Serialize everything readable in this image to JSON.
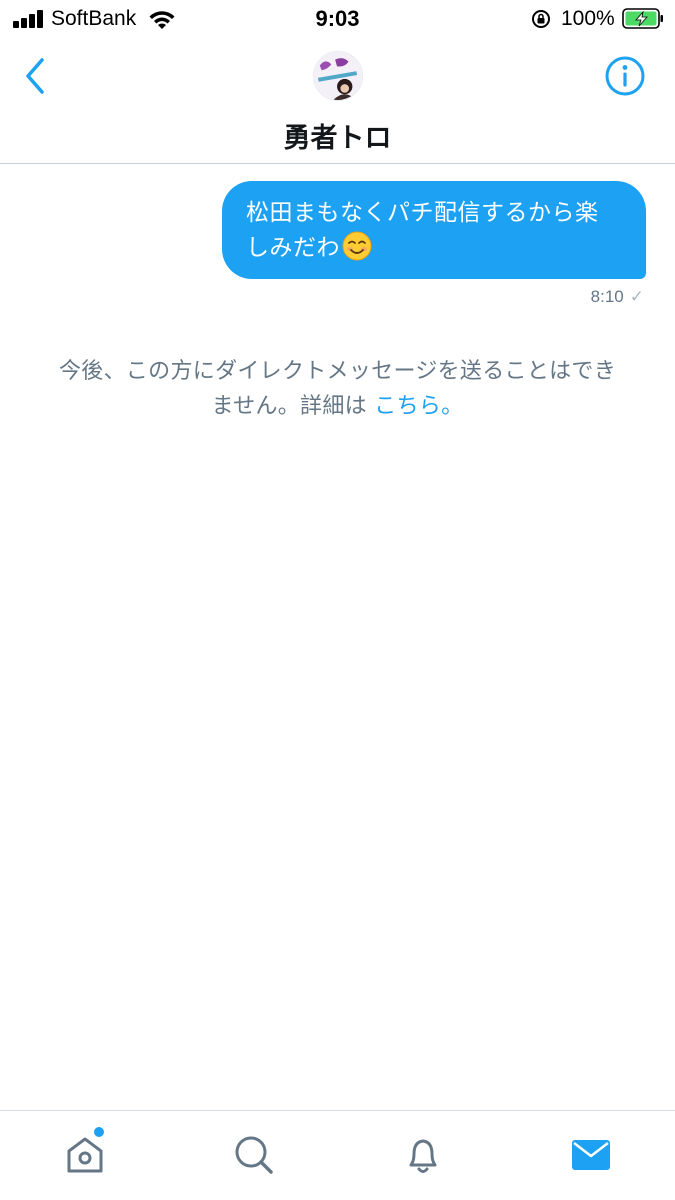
{
  "status_bar": {
    "carrier": "SoftBank",
    "time": "9:03",
    "battery_percent": "100%",
    "battery_level": 1.0,
    "signal_bars": 4
  },
  "header": {
    "contact_name": "勇者トロ",
    "avatar_icon": "user-avatar",
    "back_icon": "chevron-left-icon",
    "info_icon": "info-icon"
  },
  "conversation": {
    "messages": [
      {
        "text_line1": "松田まもなくパチ配信するから楽",
        "text_line2": "しみだわ",
        "emoji": "smiling-face-icon",
        "time": "8:10",
        "status_glyph": "✓"
      }
    ],
    "notice": {
      "text_line1": "今後、この方にダイレクトメッセージを送ることはでき",
      "text_line2": "ません。詳細は",
      "link_text": "こちら。"
    }
  },
  "tab_bar": {
    "tabs": [
      {
        "id": "home",
        "icon": "home-icon",
        "has_unread_dot": true
      },
      {
        "id": "search",
        "icon": "search-icon"
      },
      {
        "id": "notifications",
        "icon": "bell-icon"
      },
      {
        "id": "messages",
        "icon": "envelope-icon",
        "active": true
      }
    ]
  },
  "colors": {
    "accent": "#1da1f2",
    "secondary_text": "#657786",
    "primary_text": "#14171a"
  }
}
